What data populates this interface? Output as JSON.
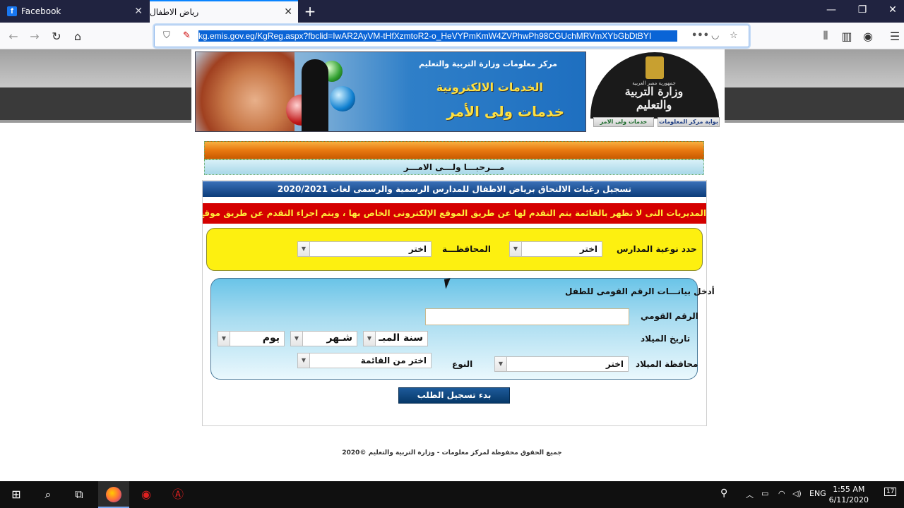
{
  "browser": {
    "tabs": [
      {
        "label": "Facebook",
        "favicon": "facebook-icon"
      },
      {
        "label": "رياض الاطفال",
        "active": true
      }
    ],
    "url": "kg.emis.gov.eg/KgReg.aspx?fbclid=IwAR2AyVM-tHfXzmtoR2-o_HeVYPmKmW4ZVPhwPh98CGUchMRVmXYbGbDtBYI"
  },
  "header": {
    "banner_line1": "مركز معلومات وزارة التربية والتعليم",
    "banner_line2": "الخدمات الالكترونية",
    "banner_line3": "خدمات ولى الأمر",
    "logo_sub": "جمهورية مصر العربية",
    "logo_text": "وزارة التربية والتعليم",
    "nav_links": [
      "بوابة مركز المعلومات",
      "خدمات ولى الامر"
    ]
  },
  "main": {
    "welcome": "مـــرحبـــا ولـــى الامـــر",
    "title": "تسجيل رغبات الالتحاق برياض الاطفال للمدارس الرسمية والرسمى لغات 2020/2021",
    "notice": "المديريات التى لا تظهر بالقائمة يتم التقدم لها عن طريق الموقع الإلكترونى الخاص بها ، ويتم اجراء التقدم عن طريق موقع المديرية",
    "school_type_label": "حدد نوعية المدارس",
    "school_type_value": "اختر",
    "governorate_label": "المحافظـــة",
    "governorate_value": "اختر",
    "nid_section_title": "أدخل بيانـــات الرقم القومى للطفل",
    "nid_label": "الرقم القومي",
    "nid_value": "",
    "birthdate_label": "تاريخ الميلاد",
    "year_value": "سنة المبـ",
    "month_value": "شـهر",
    "day_value": "يوم",
    "birth_gov_label": "محافظة الميلاد",
    "birth_gov_value": "اختر",
    "gender_label": "النوع",
    "gender_value": "اختر من القائمة",
    "submit_label": "بدء تسجيل الطلب"
  },
  "footer": {
    "text": "جميع الحقوق محفوظة لمركز معلومات - وزارة التربية والتعليم ©2020"
  },
  "taskbar": {
    "language": "ENG",
    "time": "1:55 AM",
    "date": "6/11/2020",
    "notification_count": "17"
  }
}
